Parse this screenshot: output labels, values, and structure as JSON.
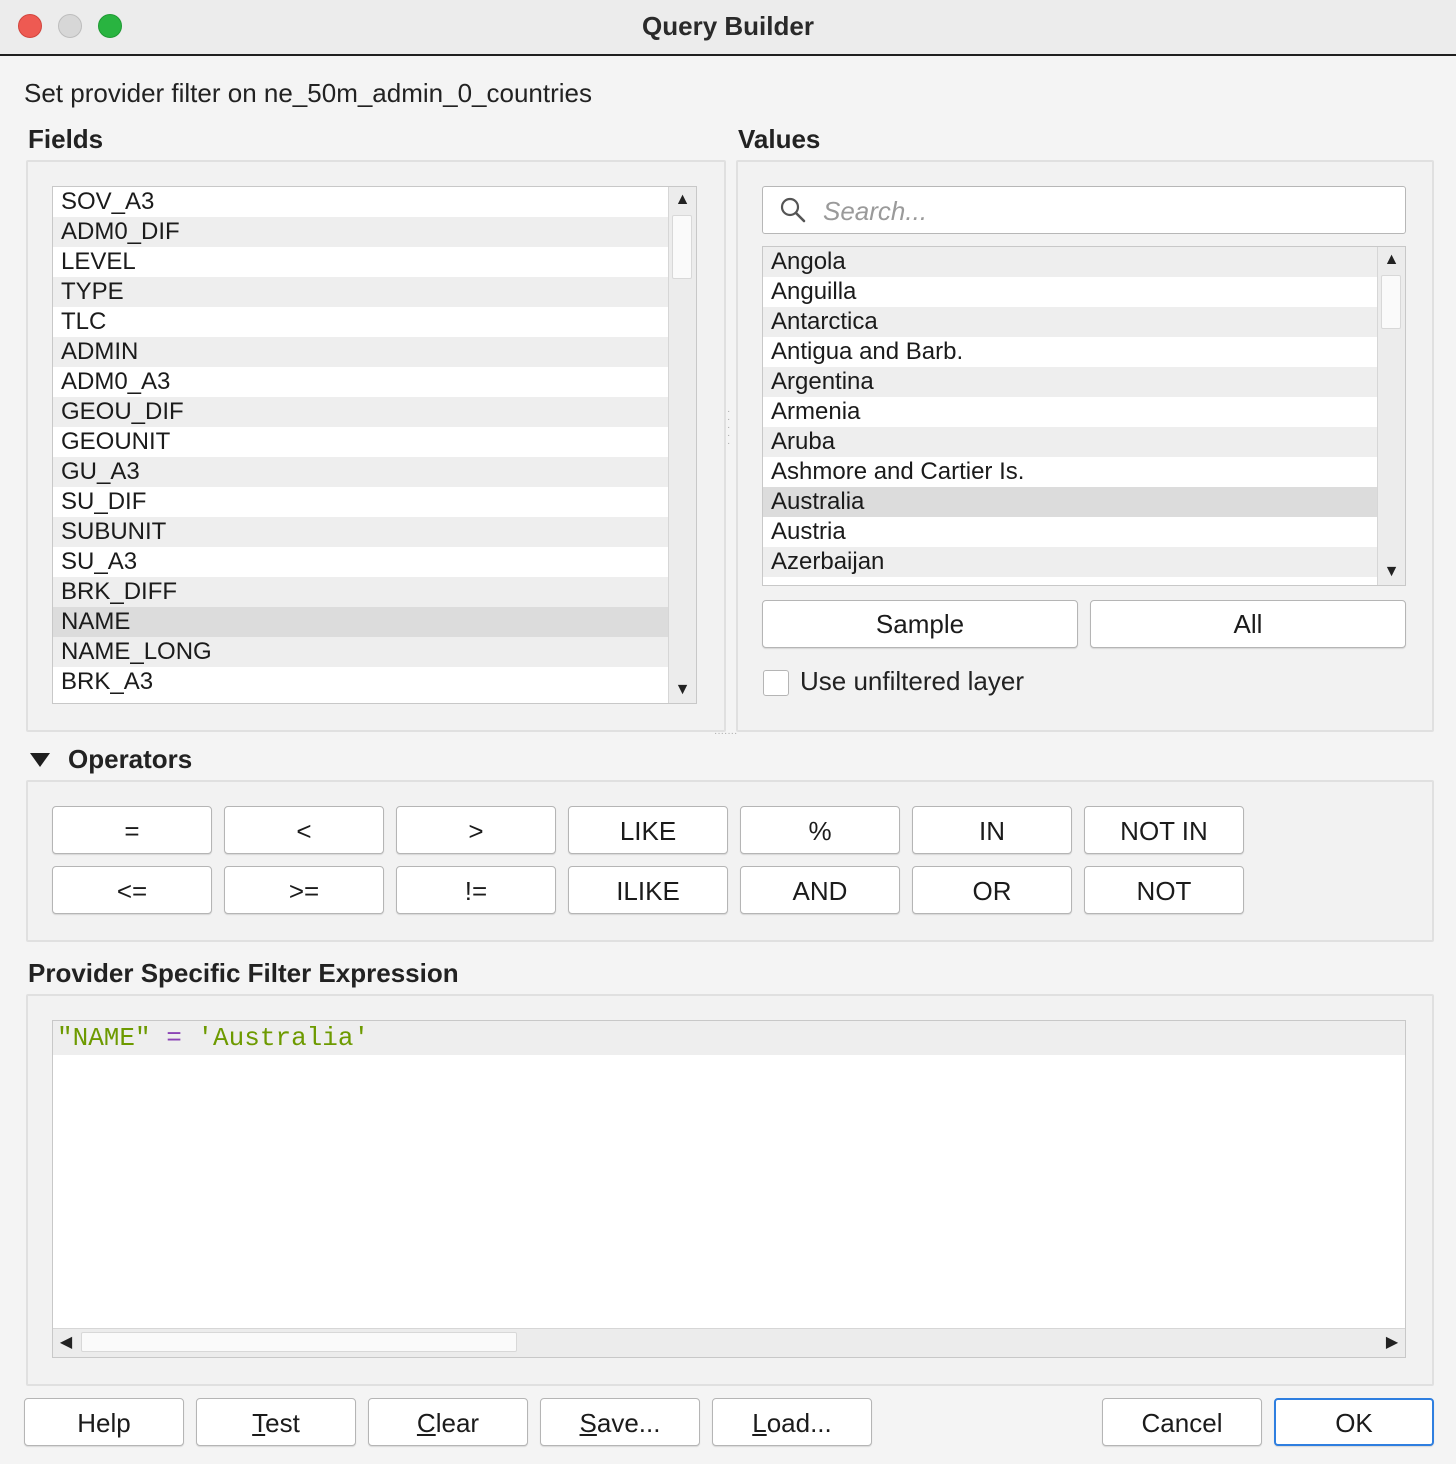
{
  "window": {
    "title": "Query Builder"
  },
  "subtitle": "Set provider filter on ne_50m_admin_0_countries",
  "fields": {
    "label": "Fields",
    "items": [
      "SOV_A3",
      "ADM0_DIF",
      "LEVEL",
      "TYPE",
      "TLC",
      "ADMIN",
      "ADM0_A3",
      "GEOU_DIF",
      "GEOUNIT",
      "GU_A3",
      "SU_DIF",
      "SUBUNIT",
      "SU_A3",
      "BRK_DIFF",
      "NAME",
      "NAME_LONG",
      "BRK_A3"
    ],
    "selected": "NAME"
  },
  "values": {
    "label": "Values",
    "search_placeholder": "Search...",
    "items": [
      "Angola",
      "Anguilla",
      "Antarctica",
      "Antigua and Barb.",
      "Argentina",
      "Armenia",
      "Aruba",
      "Ashmore and Cartier Is.",
      "Australia",
      "Austria",
      "Azerbaijan"
    ],
    "selected": "Australia",
    "sample_label": "Sample",
    "all_label": "All",
    "unfiltered_label": "Use unfiltered layer",
    "unfiltered_checked": false
  },
  "operators": {
    "label": "Operators",
    "row1": [
      "=",
      "<",
      ">",
      "LIKE",
      "%",
      "IN",
      "NOT IN"
    ],
    "row2": [
      "<=",
      ">=",
      "!=",
      "ILIKE",
      "AND",
      "OR",
      "NOT"
    ]
  },
  "expression": {
    "label": "Provider Specific Filter Expression",
    "field": "\"NAME\"",
    "operator": "=",
    "value": "'Australia'"
  },
  "buttons": {
    "help": "Help",
    "test_pre": "",
    "test_ul": "T",
    "test_post": "est",
    "clear_pre": "",
    "clear_ul": "C",
    "clear_post": "lear",
    "save_pre": "",
    "save_ul": "S",
    "save_post": "ave...",
    "load_pre": "",
    "load_ul": "L",
    "load_post": "oad...",
    "cancel": "Cancel",
    "ok": "OK"
  },
  "colors": {
    "ok_border": "#2f7fe0",
    "expr_string": "#6d9a00",
    "expr_operator": "#8b44b5"
  }
}
